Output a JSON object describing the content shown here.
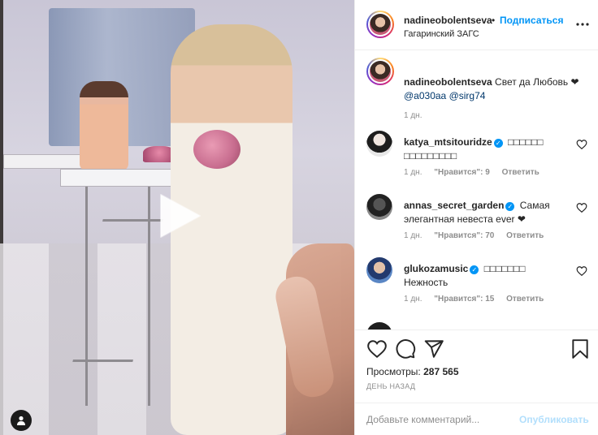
{
  "post": {
    "username": "nadineobolentseva",
    "dot": "•",
    "follow_label": "Подписаться",
    "location": "Гагаринский ЗАГС"
  },
  "caption": {
    "username": "nadineobolentseva",
    "text": "Свет да Любовь ❤",
    "mentions": [
      "@a030aa",
      "@sirg74"
    ],
    "time": "1 дн."
  },
  "comments": [
    {
      "username": "katya_mtsitouridze",
      "verified": true,
      "text": "□□□□□□ □□□□□□□□□",
      "time": "1 дн.",
      "likes": "\"Нравится\": 9",
      "reply": "Ответить"
    },
    {
      "username": "annas_secret_garden",
      "verified": true,
      "text": "Самая элегантная невеста ever ❤",
      "time": "1 дн.",
      "likes": "\"Нравится\": 70",
      "reply": "Ответить"
    },
    {
      "username": "glukozamusic",
      "verified": true,
      "text": "□□□□□□□ Нежность",
      "time": "1 дн.",
      "likes": "\"Нравится\": 15",
      "reply": "Ответить"
    }
  ],
  "stats": {
    "views_label": "Просмотры:",
    "views_count": "287 565",
    "ago": "ДЕНЬ НАЗАД"
  },
  "add_comment": {
    "placeholder": "Добавьте комментарий...",
    "publish_label": "Опубликовать"
  },
  "colors": {
    "accent": "#0095f6",
    "muted": "#8e8e8e",
    "publish_disabled": "#b2dffc"
  },
  "icons": {
    "play": "play-icon",
    "heart": "heart-icon",
    "comment": "comment-icon",
    "share": "share-icon",
    "save": "bookmark-icon",
    "more": "more-icon",
    "user_tag": "user-tag-icon"
  }
}
